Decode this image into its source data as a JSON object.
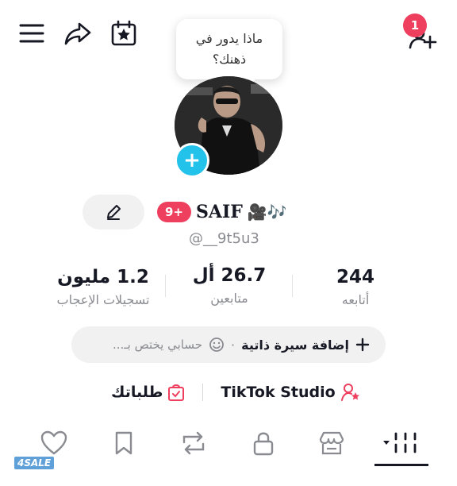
{
  "notifications": {
    "count": "1"
  },
  "bubble": {
    "text": "ماذا يدور في ذهنك؟"
  },
  "profile": {
    "level_badge": "9+",
    "display_name": "SAIF",
    "name_emoji": "🎥🎶",
    "username": "@__9t5u3"
  },
  "stats": [
    {
      "value": "1.2 مليون",
      "label": "تسجيلات الإعجاب"
    },
    {
      "value": "26.7 أل",
      "label": "متابعين"
    },
    {
      "value": "244",
      "label": "أتابعه"
    }
  ],
  "bio": {
    "add_label": "إضافة سيرة ذاتية",
    "separator": "·",
    "status_text": "حسابي يختص بـ..."
  },
  "links": {
    "studio": "TikTok Studio",
    "orders": "طلباتك"
  },
  "watermark": "4SALE",
  "icons": {
    "menu": "hamburger-icon",
    "share": "share-icon",
    "calendar": "calendar-star-icon",
    "add_friend": "add-user-icon",
    "edit": "pencil-icon",
    "add": "plus-icon",
    "emoji": "smile-icon",
    "studio": "person-star-icon",
    "orders": "bag-check-icon",
    "tabs": [
      "heart-icon",
      "bookmark-icon",
      "repost-icon",
      "lock-icon",
      "shop-icon",
      "grid-icon"
    ]
  },
  "colors": {
    "accent": "#ee3f5f",
    "cyan": "#23c2ea",
    "text": "#161823",
    "muted": "#8a8b91"
  }
}
